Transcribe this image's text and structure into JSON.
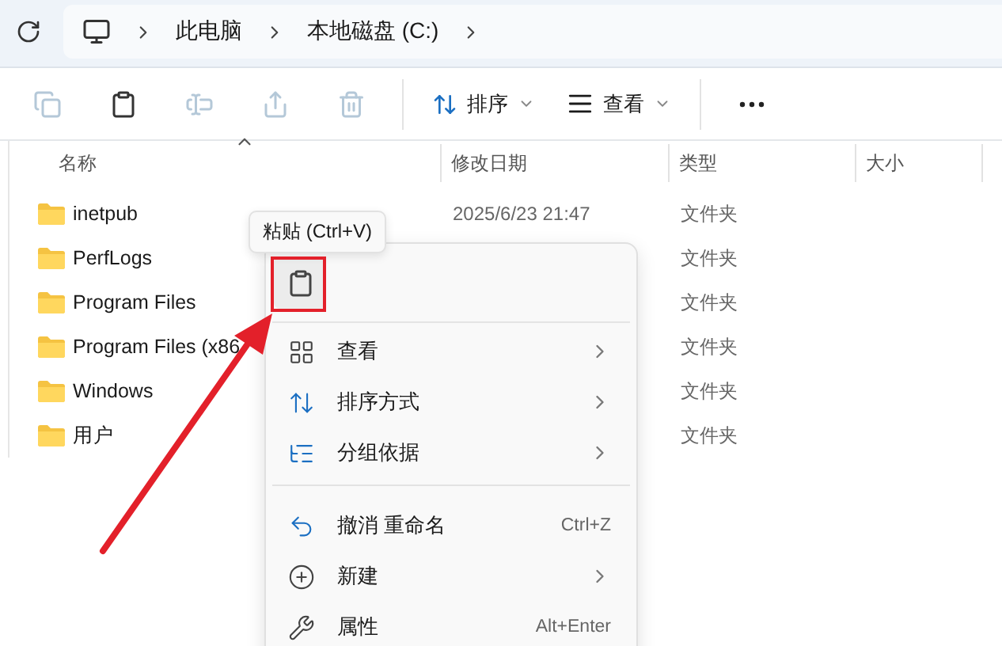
{
  "address_bar": {
    "path": [
      "此电脑",
      "本地磁盘 (C:)"
    ]
  },
  "toolbar": {
    "buttons": [
      {
        "kind": "copy",
        "disabled": true
      },
      {
        "kind": "paste",
        "disabled": false
      },
      {
        "kind": "rename",
        "disabled": true
      },
      {
        "kind": "share",
        "disabled": true
      },
      {
        "kind": "delete",
        "disabled": true
      }
    ],
    "sort": {
      "label": "排序"
    },
    "view": {
      "label": "查看"
    }
  },
  "table": {
    "columns": [
      "名称",
      "修改日期",
      "类型",
      "大小"
    ],
    "rows": [
      {
        "name": "inetpub",
        "modified": "2025/6/23 21:47",
        "type": "文件夹"
      },
      {
        "name": "PerfLogs",
        "type": "文件夹"
      },
      {
        "name": "Program Files",
        "type": "文件夹"
      },
      {
        "name": "Program Files (x86",
        "type": "文件夹"
      },
      {
        "name": "Windows",
        "type": "文件夹"
      },
      {
        "name": "用户",
        "type": "文件夹"
      }
    ]
  },
  "tooltip": {
    "text": "粘贴 (Ctrl+V)"
  },
  "context_menu": {
    "icon_buttons": [
      {
        "kind": "paste",
        "highlighted": true
      }
    ],
    "items": [
      {
        "kind": "view",
        "label": "查看",
        "submenu": true,
        "separator_before": false
      },
      {
        "kind": "sort",
        "label": "排序方式",
        "submenu": true,
        "separator_before": false
      },
      {
        "kind": "group",
        "label": "分组依据",
        "submenu": true,
        "separator_before": false
      },
      {
        "kind": "undo",
        "label": "撤消 重命名",
        "shortcut": "Ctrl+Z",
        "submenu": false,
        "separator_before": true
      },
      {
        "kind": "new",
        "label": "新建",
        "submenu": true,
        "separator_before": false
      },
      {
        "kind": "properties",
        "label": "属性",
        "shortcut": "Alt+Enter",
        "submenu": false,
        "separator_before": false
      }
    ]
  },
  "annotation": {
    "shown": true
  }
}
